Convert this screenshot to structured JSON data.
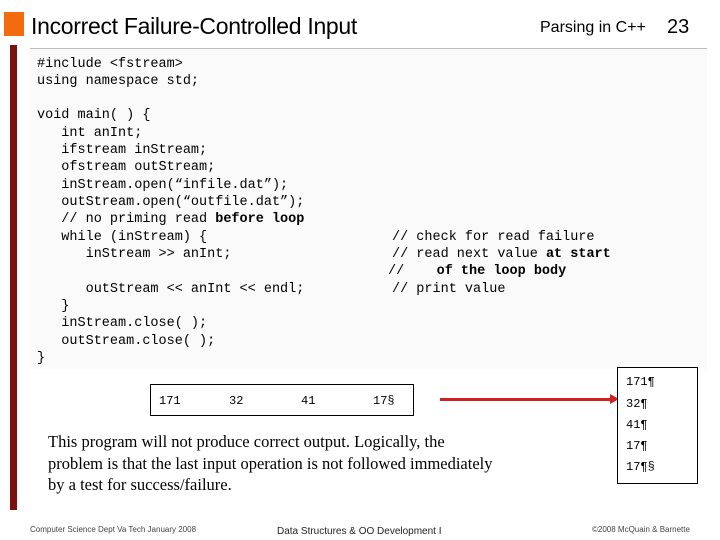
{
  "header": {
    "title": "Incorrect Failure-Controlled Input",
    "section": "Parsing in C++",
    "page_number": "23"
  },
  "code": [
    [
      {
        "t": "#include <fstream>"
      }
    ],
    [
      {
        "t": "using namespace std;"
      }
    ],
    [
      {
        "t": "void main( ) {"
      }
    ],
    [
      {
        "t": "   int anInt;"
      }
    ],
    [
      {
        "t": "   ifstream inStream;"
      }
    ],
    [
      {
        "t": "   ofstream outStream;"
      }
    ],
    [
      {
        "t": "   inStream.open(“infile.dat”);"
      }
    ],
    [
      {
        "t": "   outStream.open(“outfile.dat”);"
      }
    ],
    [
      {
        "t": "   // no priming read "
      },
      {
        "t": "before loop",
        "b": true
      }
    ],
    [
      {
        "t": "   while (inStream) {"
      }
    ],
    [
      {
        "t": "      inStream >> anInt;"
      }
    ],
    [
      {
        "t": ""
      }
    ],
    [
      {
        "t": "      outStream << anInt << endl;"
      }
    ],
    [
      {
        "t": "   }"
      }
    ],
    [
      {
        "t": "   inStream.close( );"
      }
    ],
    [
      {
        "t": "   outStream.close( );"
      }
    ],
    [
      {
        "t": "}"
      }
    ]
  ],
  "comments": [
    [
      {
        "t": "// check for read failure"
      }
    ],
    [
      {
        "t": "// read next value "
      },
      {
        "t": "at start",
        "b": true
      }
    ],
    [
      {
        "t": "//    "
      },
      {
        "t": "of the loop body",
        "b": true
      }
    ],
    [
      {
        "t": "// print value"
      }
    ]
  ],
  "input_file": [
    "171",
    "32",
    "41",
    "17§"
  ],
  "output_file": [
    "171¶",
    "32¶",
    "41¶",
    "17¶",
    "17¶§"
  ],
  "explanation": "This program will not produce correct output.  Logically, the problem is that the last input operation is not followed immediately by a test for success/failure.",
  "footer": {
    "left": "Computer Science Dept Va Tech January 2008",
    "center": "Data Structures & OO Development I",
    "right": "©2008  McQuain & Barnette"
  },
  "colors": {
    "accent": "#f26b0f",
    "sidebar": "#7a1010",
    "arrow": "#d02020"
  }
}
